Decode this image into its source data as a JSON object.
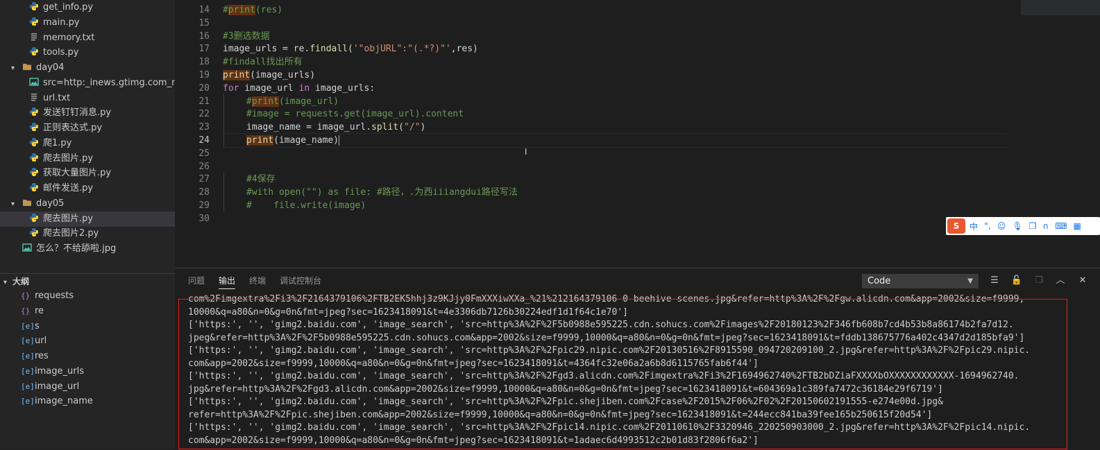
{
  "explorer": {
    "items": [
      {
        "label": "get_info.py",
        "type": "py"
      },
      {
        "label": "main.py",
        "type": "py"
      },
      {
        "label": "memory.txt",
        "type": "txt"
      },
      {
        "label": "tools.py",
        "type": "py"
      },
      {
        "label": "day04",
        "type": "folder"
      },
      {
        "label": "src=http:_inews.gtimg.com_ne...",
        "type": "img"
      },
      {
        "label": "url.txt",
        "type": "txt"
      },
      {
        "label": "发送钉钉消息.py",
        "type": "py"
      },
      {
        "label": "正则表达式.py",
        "type": "py"
      },
      {
        "label": "爬1.py",
        "type": "py"
      },
      {
        "label": "爬去图片.py",
        "type": "py"
      },
      {
        "label": "获取大量图片.py",
        "type": "py"
      },
      {
        "label": "邮件发送.py",
        "type": "py"
      },
      {
        "label": "day05",
        "type": "folder"
      },
      {
        "label": "爬去图片.py",
        "type": "py"
      },
      {
        "label": "爬去图片2.py",
        "type": "py"
      },
      {
        "label": "怎么？不给舔啦.jpg",
        "type": "img"
      }
    ]
  },
  "outline": {
    "title": "大纲",
    "items": [
      {
        "label": "requests",
        "kind": "{}"
      },
      {
        "label": "re",
        "kind": "{}"
      },
      {
        "label": "s",
        "kind": "[e]"
      },
      {
        "label": "url",
        "kind": "[e]"
      },
      {
        "label": "res",
        "kind": "[e]"
      },
      {
        "label": "image_urls",
        "kind": "[e]"
      },
      {
        "label": "image_url",
        "kind": "[e]"
      },
      {
        "label": "image_name",
        "kind": "[e]"
      }
    ]
  },
  "editor": {
    "line_numbers": [
      "14",
      "15",
      "16",
      "17",
      "18",
      "19",
      "20",
      "21",
      "22",
      "23",
      "24",
      "25",
      "26",
      "27",
      "28",
      "29",
      "30"
    ],
    "active_line": "24",
    "l14_a": "#",
    "l14_b": "print",
    "l14_c": "(res)",
    "l16": "#3删选数据",
    "l17_a": "image_urls = re.",
    "l17_b": "findall",
    "l17_c": "(",
    "l17_d": "'\"objURL\":\"(.*?)\"'",
    "l17_e": ",res)",
    "l18": "#findall找出所有",
    "l19_a": "print",
    "l19_b": "(image_urls)",
    "l20_a": "for",
    "l20_b": " image_url ",
    "l20_c": "in",
    "l20_d": " image_urls:",
    "l21_a": "#",
    "l21_b": "print",
    "l21_c": "(image_url)",
    "l22": "#image = requests.get(image_url).content",
    "l23_a": "image_name = image_url.",
    "l23_b": "split",
    "l23_c": "(",
    "l23_d": "\"/\"",
    "l23_e": ")",
    "l24_a": "print",
    "l24_b": "(image_name)",
    "l27": "#4保存",
    "l28": "#with open(\"\") as file: #路径，.为西iiiangdui路径写法",
    "l29": "#    file.write(image)"
  },
  "ime": {
    "logo": "S",
    "mode": "中",
    "punct": "°,"
  },
  "panel": {
    "tabs": [
      "问题",
      "输出",
      "终端",
      "调试控制台"
    ],
    "active_tab": "输出",
    "channel": "Code",
    "output_lines": [
      "com%2Fimgextra%2Fi3%2F2164379106%2FTB2EK5hhj3z9KJjy0FmXXXiwXXa_%21%212164379106-0-beehive-scenes.jpg&refer=http%3A%2F%2Fgw.alicdn.com&app=2002&size=f9999,",
      "10000&q=a80&n=0&g=0n&fmt=jpeg?sec=1623418091&t=4e3306db7126b30224edf1d1f64c1e70']",
      "['https:', '', 'gimg2.baidu.com', 'image_search', 'src=http%3A%2F%2F5b0988e595225.cdn.sohucs.com%2Fimages%2F20180123%2F346fb608b7cd4b53b8a86174b2fa7d12.",
      "jpeg&refer=http%3A%2F%2F5b0988e595225.cdn.sohucs.com&app=2002&size=f9999,10000&q=a80&n=0&g=0n&fmt=jpeg?sec=1623418091&t=fddb138675776a402c4347d2d185bfa9']",
      "['https:', '', 'gimg2.baidu.com', 'image_search', 'src=http%3A%2F%2Fpic29.nipic.com%2F20130516%2F8915590_094720209100_2.jpg&refer=http%3A%2F%2Fpic29.nipic.",
      "com&app=2002&size=f9999,10000&q=a80&n=0&g=0n&fmt=jpeg?sec=1623418091&t=4364fc32e06a2a6b8d6115765fab6f44']",
      "['https:', '', 'gimg2.baidu.com', 'image_search', 'src=http%3A%2F%2Fgd3.alicdn.com%2Fimgextra%2Fi3%2F1694962740%2FTB2bDZiaFXXXXbOXXXXXXXXXXXX-1694962740.",
      "jpg&refer=http%3A%2F%2Fgd3.alicdn.com&app=2002&size=f9999,10000&q=a80&n=0&g=0n&fmt=jpeg?sec=1623418091&t=604369a1c389fa7472c36184e29f6719']",
      "['https:', '', 'gimg2.baidu.com', 'image_search', 'src=http%3A%2F%2Fpic.shejiben.com%2Fcase%2F2015%2F06%2F02%2F20150602191555-e274e00d.jpg&",
      "refer=http%3A%2F%2Fpic.shejiben.com&app=2002&size=f9999,10000&q=a80&n=0&g=0n&fmt=jpeg?sec=1623418091&t=244ecc841ba39fee165b250615f20d54']",
      "['https:', '', 'gimg2.baidu.com', 'image_search', 'src=http%3A%2F%2Fpic14.nipic.com%2F20110610%2F3320946_220250903000_2.jpg&refer=http%3A%2F%2Fpic14.nipic.",
      "com&app=2002&size=f9999,10000&q=a80&n=0&g=0n&fmt=jpeg?sec=1623418091&t=1adaec6d4993512c2b01d83f2806f6a2']"
    ]
  },
  "colors": {
    "annotation_box": "#e52020",
    "python_icon": "#3572a5",
    "folder_icon": "#c09553"
  }
}
